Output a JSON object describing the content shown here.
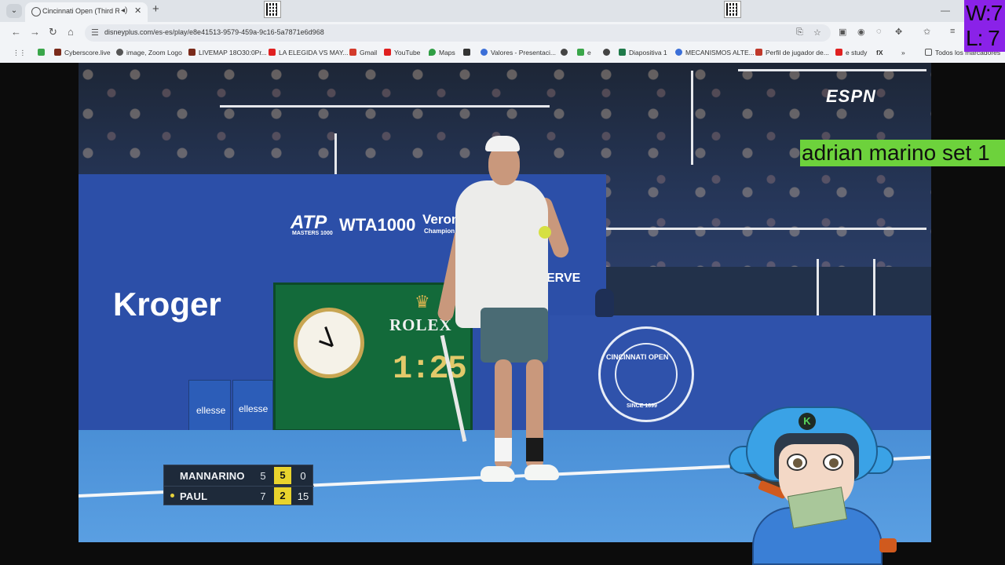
{
  "browser": {
    "tab": {
      "title": "Cincinnati Open (Third Rou",
      "audio_icon": "speaker-icon",
      "close_label": "✕"
    },
    "new_tab_label": "+",
    "url": "disneyplus.com/es-es/play/e8e41513-9579-459a-9c16-5a7871e6d968",
    "bookmarks": [
      {
        "label": "",
        "color": "#3aa64a"
      },
      {
        "label": "Cyberscore.live",
        "color": "#7a2a1a"
      },
      {
        "label": "image, Zoom Logo",
        "color": "#555555"
      },
      {
        "label": "LIVEMAP 18O30:0Pr...",
        "color": "#7a2a1a"
      },
      {
        "label": "LA ELEGIDA VS MAY...",
        "color": "#e02020"
      },
      {
        "label": "Gmail",
        "color": "#d33b2c"
      },
      {
        "label": "YouTube",
        "color": "#e02020"
      },
      {
        "label": "Maps",
        "color": "#2f9e44"
      },
      {
        "label": "",
        "color": "#333333"
      },
      {
        "label": "Valores - Presentaci...",
        "color": "#3b6fd8"
      },
      {
        "label": "",
        "color": "#444444"
      },
      {
        "label": "e",
        "color": "#3aa64a"
      },
      {
        "label": "",
        "color": "#444444"
      },
      {
        "label": "Diapositiva 1",
        "color": "#1f7a4a"
      },
      {
        "label": "MECANISMOS ALTE...",
        "color": "#3b6fd8"
      },
      {
        "label": "Perfil de jugador de...",
        "color": "#c0392b"
      },
      {
        "label": "e study",
        "color": "#e02020"
      },
      {
        "label": "fX",
        "color": "#333333"
      }
    ],
    "bookmarks_overflow": "»",
    "all_bookmarks_label": "Todos los marcadores"
  },
  "counter": {
    "wins": "W:7",
    "losses": "L: 7"
  },
  "video": {
    "broadcaster": "ESPN",
    "sponsors": {
      "atp": "ATP",
      "atp_sub": "MASTERS 1000",
      "wta": "WTA1000",
      "veron": "Veron",
      "veron_sub": "Champion",
      "kroger": "Kroger",
      "rolex": "ROLEX",
      "serve": "ERVE",
      "cincinnati": "CINCINNATI OPEN",
      "cincinnati_since": "SINCE 1899",
      "ellesse": "ellesse"
    },
    "shot_clock": "1:25"
  },
  "scoreboard": {
    "players": [
      {
        "name": "MANNARINO",
        "serving": false,
        "set1": "5",
        "current_set": "5",
        "points": "0"
      },
      {
        "name": "PAUL",
        "serving": true,
        "set1": "7",
        "current_set": "2",
        "points": "15"
      }
    ]
  },
  "overlay_label": "adrian marino set 1",
  "avatar": {
    "badge_letter": "K"
  }
}
